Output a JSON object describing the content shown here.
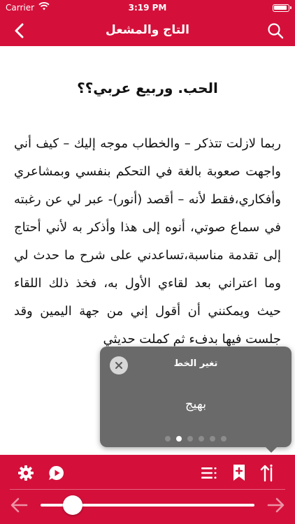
{
  "status_bar": {
    "carrier": "Carrier",
    "time": "3:19 PM"
  },
  "nav": {
    "title": "التاج والمشعل"
  },
  "content": {
    "chapter_title": "الحب. وربيع عربي؟؟",
    "paragraph": "ربما لازلت تتذكر – والخطاب موجه إليك – كيف أني واجهت صعوبة بالغة في التحكم بنفسي وبمشاعري وأفكاري،فقط لأنه – أقصد (أنور)- عبر لي عن رغبته في سماع صوتي، أنوه إلى هذا وأذكر به لأني أحتاج إلى تقدمة مناسبة،تساعدني على شرح ما حدث لي وما اعتراني بعد لقاءي الأول به، فخذ ذلك اللقاء حيث ويمكنني أن أقول إني من جهة اليمين وقد جلست فيها بدفء ثم كملت حديثي"
  },
  "font_popover": {
    "title": "تغير الخط",
    "selected_font": "بهيج",
    "page_count": 6,
    "active_page": 1
  },
  "reading_progress": 0.15,
  "colors": {
    "brand": "#d4103a",
    "popover_bg": "#6a6a6a"
  },
  "icons": {
    "back": "chevron-left-icon",
    "search": "search-icon",
    "settings": "gear-icon",
    "audio": "speech-play-icon",
    "toc": "list-icon",
    "bookmark": "bookmark-add-icon",
    "sort": "sort-icon",
    "prev": "arrow-left-icon",
    "next": "arrow-right-icon",
    "close": "close-icon"
  }
}
